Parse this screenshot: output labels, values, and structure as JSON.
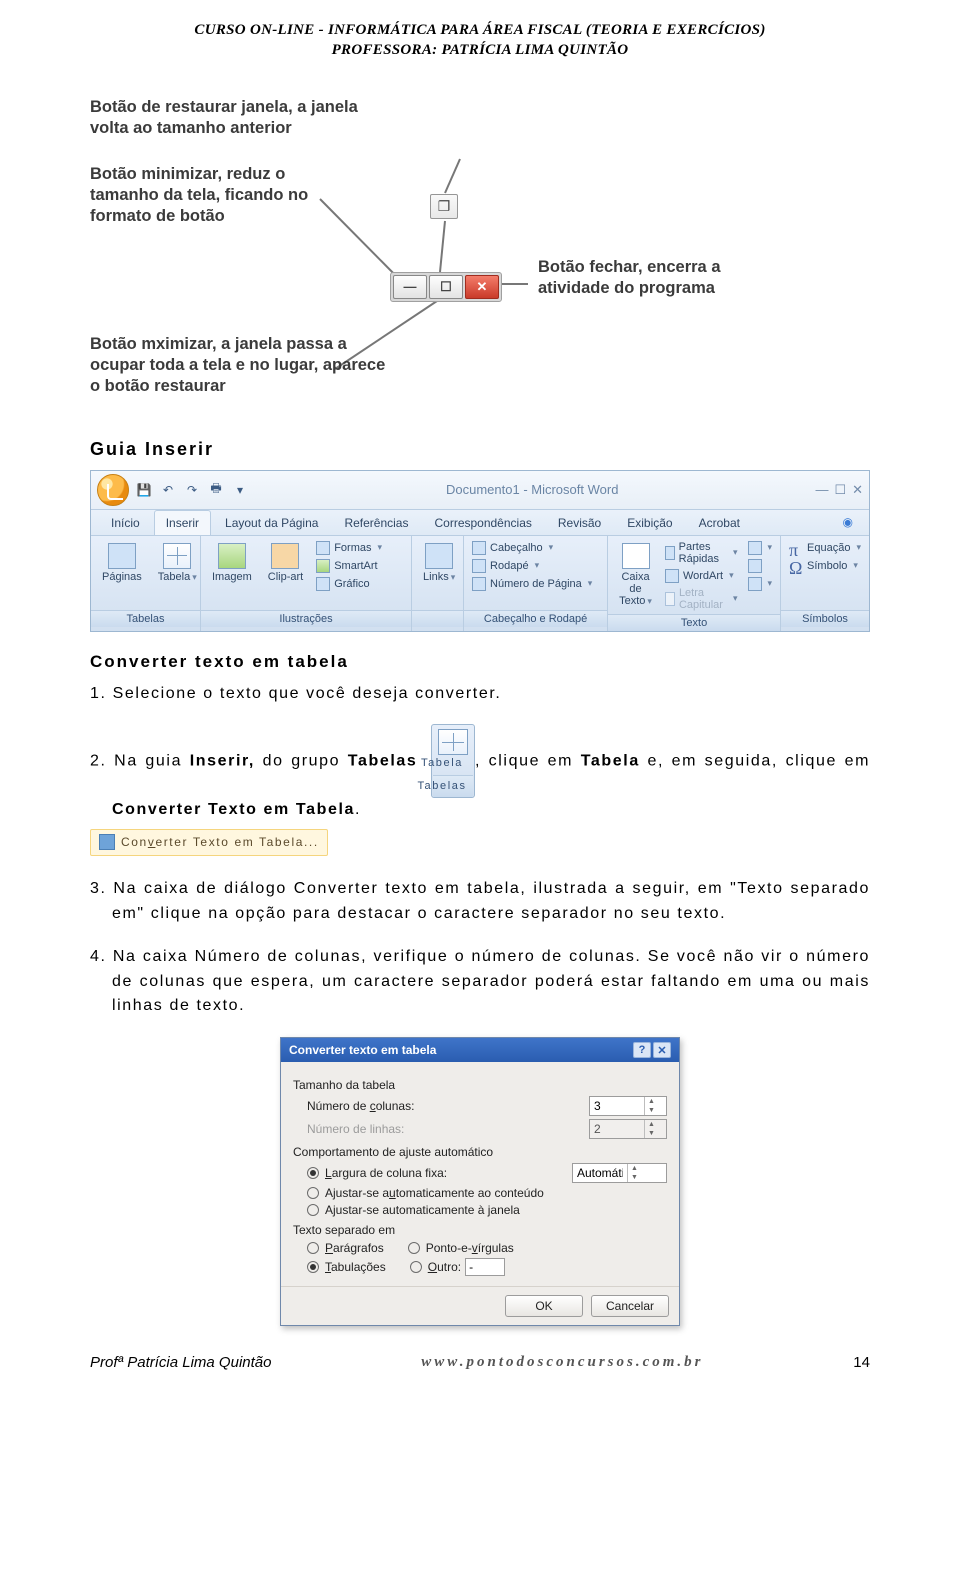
{
  "header": {
    "line1": "CURSO ON-LINE - INFORMÁTICA PARA ÁREA FISCAL (TEORIA E EXERCÍCIOS)",
    "line2": "PROFESSORA: PATRÍCIA LIMA QUINTÃO"
  },
  "diagram": {
    "minimize": "Botão minimizar, reduz o tamanho da tela, ficando no formato de botão",
    "restore": "Botão de restaurar janela, a janela volta ao tamanho anterior",
    "close": "Botão fechar, encerra a atividade do programa",
    "maximize": "Botão mximizar, a janela passa a ocupar toda a tela e no lugar, aparece o botão restaurar"
  },
  "section": {
    "guia_inserir": "Guia Inserir",
    "converter_title": "Converter texto em tabela",
    "step1": "1. Selecione o texto que você deseja converter.",
    "step2_a": "2. Na guia ",
    "step2_inserir": "Inserir,",
    "step2_b": " do grupo ",
    "step2_tabelas": "Tabelas",
    "step2_c": ", clique em ",
    "step2_tabela": "Tabela",
    "step2_d": " e, em seguida, clique em ",
    "step2_conv": "Converter Texto em Tabela",
    "step2_e": ".",
    "step3": "3. Na caixa de diálogo Converter texto em tabela, ilustrada a seguir, em \"Texto separado em\" clique na opção para destacar o caractere separador no seu texto.",
    "step4": "4. Na caixa Número de colunas, verifique o número de colunas. Se você não vir o número de colunas que espera, um caractere separador poderá estar faltando em uma ou mais linhas de texto."
  },
  "ribbon": {
    "doc_title": "Documento1 - Microsoft Word",
    "tabs": [
      "Início",
      "Inserir",
      "Layout da Página",
      "Referências",
      "Correspondências",
      "Revisão",
      "Exibição",
      "Acrobat"
    ],
    "groups": {
      "tabelas": {
        "label": "Tabelas",
        "items": [
          "Páginas",
          "Tabela"
        ]
      },
      "ilustracoes": {
        "label": "Ilustrações",
        "items": [
          "Imagem",
          "Clip-art",
          "Formas",
          "SmartArt",
          "Gráfico"
        ]
      },
      "links": {
        "label": "",
        "items": [
          "Links"
        ]
      },
      "cab_rodape": {
        "label": "Cabeçalho e Rodapé",
        "items": [
          "Cabeçalho",
          "Rodapé",
          "Número de Página"
        ]
      },
      "texto": {
        "label": "Texto",
        "items": [
          "Caixa de Texto",
          "Partes Rápidas",
          "WordArt",
          "Letra Capitular"
        ]
      },
      "simbolos": {
        "label": "Símbolos",
        "items": [
          "Equação",
          "Símbolo"
        ]
      }
    }
  },
  "tabela_chunk": {
    "btn": "Tabela",
    "group": "Tabelas",
    "menu_item": "Converter Texto em Tabela..."
  },
  "dialog": {
    "title": "Converter texto em tabela",
    "grp_tamanho": "Tamanho da tabela",
    "num_colunas": "Número de colunas:",
    "num_colunas_val": "3",
    "num_linhas": "Número de linhas:",
    "num_linhas_val": "2",
    "grp_ajuste": "Comportamento de ajuste automático",
    "opt_largura": "Largura de coluna fixa:",
    "opt_largura_val": "Automático",
    "opt_conteudo": "Ajustar-se automaticamente ao conteúdo",
    "opt_janela": "Ajustar-se automaticamente à janela",
    "grp_separado": "Texto separado em",
    "opt_paragrafos": "Parágrafos",
    "opt_pontovirg": "Ponto-e-vírgulas",
    "opt_tabulacoes": "Tabulações",
    "opt_outro": "Outro:",
    "opt_outro_val": "-",
    "btn_ok": "OK",
    "btn_cancel": "Cancelar"
  },
  "footer": {
    "left": "Profª Patrícia Lima Quintão",
    "mid": "www.pontodosconcursos.com.br",
    "page": "14"
  }
}
